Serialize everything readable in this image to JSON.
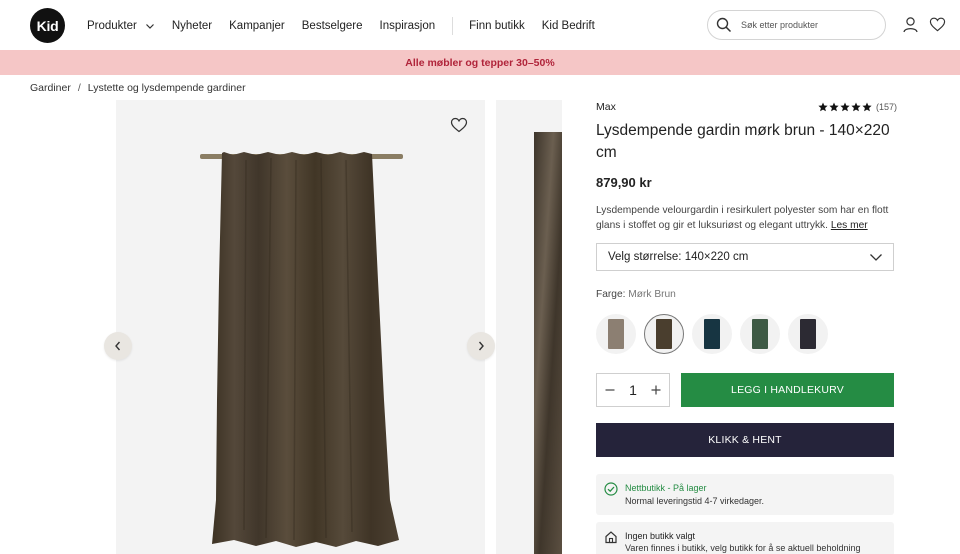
{
  "header": {
    "logo_text": "Kid",
    "nav": [
      {
        "label": "Produkter",
        "has_dropdown": true
      },
      {
        "label": "Nyheter"
      },
      {
        "label": "Kampanjer"
      },
      {
        "label": "Bestselgere"
      },
      {
        "label": "Inspirasjon"
      }
    ],
    "nav_secondary": [
      {
        "label": "Finn butikk"
      },
      {
        "label": "Kid Bedrift"
      }
    ],
    "search_placeholder": "Søk etter produkter",
    "icons": [
      "search-icon",
      "user-icon",
      "heart-icon"
    ]
  },
  "promo": {
    "text": "Alle møbler og tepper 30–50%",
    "bg": "#f5c6c6",
    "color": "#b0243a"
  },
  "breadcrumb": [
    "Gardiner",
    "Lystette og lysdempende gardiner"
  ],
  "product": {
    "brand": "Max",
    "rating": 5,
    "review_count": "(157)",
    "title": "Lysdempende gardin mørk brun - 140×220 cm",
    "price": "879,90 kr",
    "description": "Lysdempende velourgardin i resirkulert polyester som har en flott glans i stoffet og gir et luksuriøst og elegant uttrykk.",
    "read_more": "Les mer",
    "size_select": "Velg størrelse: 140×220 cm",
    "color_label": "Farge:",
    "color_value": "Mørk Brun",
    "swatches": [
      {
        "name": "beige",
        "color": "#8c7f72",
        "selected": false
      },
      {
        "name": "mork-brun",
        "color": "#4a3e2e",
        "selected": true
      },
      {
        "name": "petrol",
        "color": "#173542",
        "selected": false
      },
      {
        "name": "gronn",
        "color": "#3e5a45",
        "selected": false
      },
      {
        "name": "antrasitt",
        "color": "#2c2a33",
        "selected": false
      }
    ],
    "quantity": "1",
    "add_to_cart": "LEGG I HANDLEKURV",
    "click_collect": "KLIKK & HENT",
    "stock_title": "Nettbutikk - På lager",
    "stock_detail": "Normal leveringstid 4-7 virkedager.",
    "store_title": "Ingen butikk valgt",
    "store_detail": "Varen finnes i butikk, velg butikk for å se aktuell beholdning"
  },
  "colors": {
    "accent_green": "#258c44",
    "dark_button": "#25233a"
  }
}
